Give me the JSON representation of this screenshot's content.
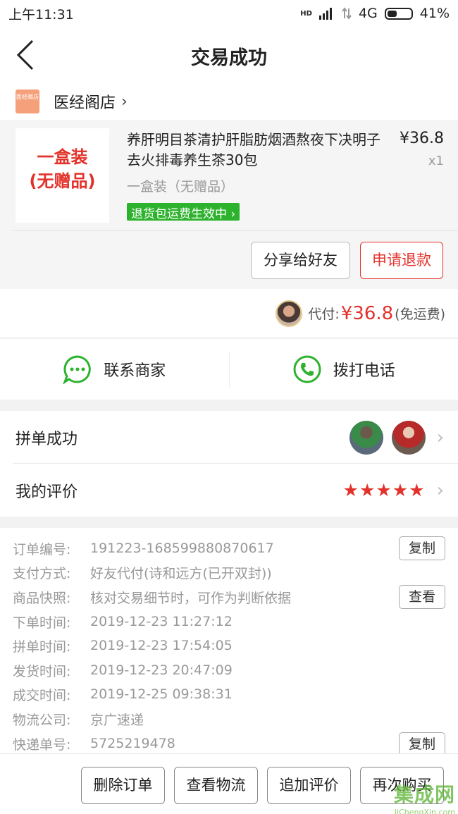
{
  "status_bar": {
    "time": "上午11:31",
    "signal_hd": "HD",
    "network": "4G",
    "battery": "41%",
    "battery_level": 0.41
  },
  "nav": {
    "title": "交易成功",
    "back_icon": "chevron-left-icon"
  },
  "store": {
    "logo_text": "医经阁店",
    "name": "医经阁店",
    "arrow": "›"
  },
  "product": {
    "thumb_line1": "一盒装",
    "thumb_line2": "(无赠品)",
    "title": "养肝明目茶清护肝脂肪烟酒熬夜下决明子去火排毒养生茶30包",
    "price": "¥36.8",
    "qty": "x1",
    "variant": "一盒装（无赠品）",
    "badge": "退货包运费生效中",
    "badge_arrow": "›"
  },
  "actions": {
    "share": "分享给好友",
    "refund": "申请退款"
  },
  "payment": {
    "label": "代付:",
    "amount": "¥36.8",
    "shipping": "(免运费)"
  },
  "contact": {
    "merchant": "联系商家",
    "call": "拨打电话"
  },
  "group": {
    "label": "拼单成功",
    "chevron": "›"
  },
  "review": {
    "label": "我的评价",
    "stars": "★★★★★",
    "rating": 5,
    "chevron": "›"
  },
  "order_info": {
    "rows": [
      {
        "label": "订单编号:",
        "value": "191223-168599880870617"
      },
      {
        "label": "支付方式:",
        "value": "好友代付(诗和远方(已开双封))"
      },
      {
        "label": "商品快照:",
        "value": "核对交易细节时，可作为判断依据"
      },
      {
        "label": "下单时间:",
        "value": "2019-12-23 11:27:12"
      },
      {
        "label": "拼单时间:",
        "value": "2019-12-23 17:54:05"
      },
      {
        "label": "发货时间:",
        "value": "2019-12-23 20:47:09"
      },
      {
        "label": "成交时间:",
        "value": "2019-12-25 09:38:31"
      },
      {
        "label": "物流公司:",
        "value": "京广速递"
      },
      {
        "label": "快递单号:",
        "value": "5725219478"
      }
    ],
    "copy_label": "复制",
    "view_label": "查看"
  },
  "bottom": {
    "delete": "删除订单",
    "logistics": "查看物流",
    "add_review": "追加评价",
    "rebuy": "再次购买"
  },
  "watermark": {
    "logo": "集成网",
    "url": "JiChengXin.com"
  },
  "colors": {
    "accent_red": "#e3322b",
    "green": "#2db22d"
  }
}
